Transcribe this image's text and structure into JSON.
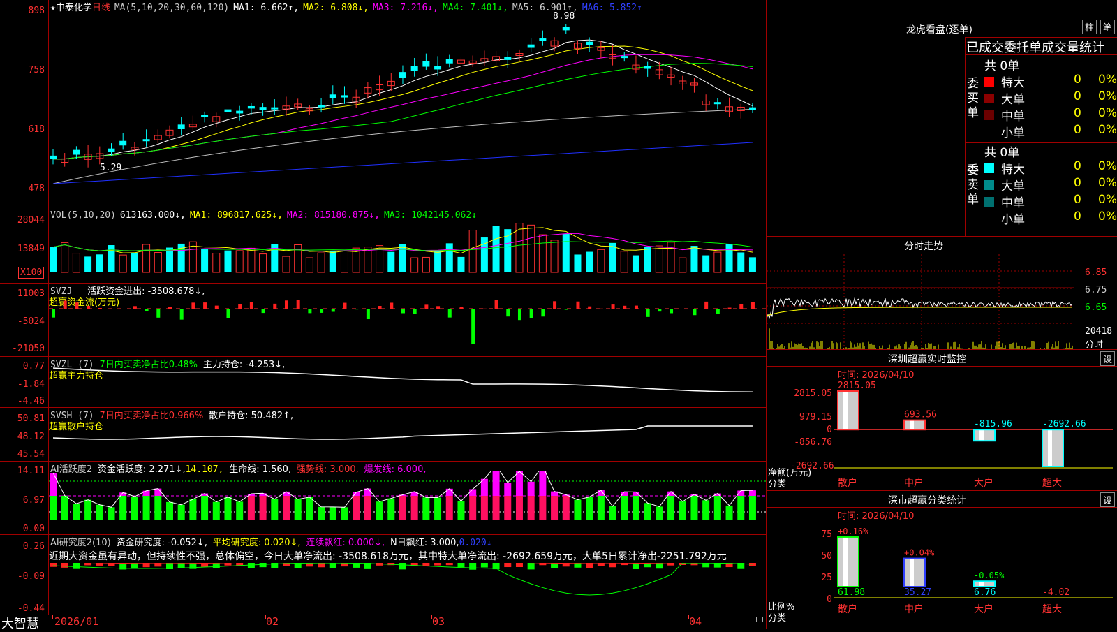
{
  "kline": {
    "star": "★",
    "stock_name": "中泰化学",
    "period": "日线",
    "ma_label": "MA(5,10,20,30,60,120)",
    "ma1": "MA1: 6.662↑,",
    "ma2": "MA2: 6.808↓,",
    "ma3": "MA3: 7.216↓,",
    "ma4": "MA4: 7.401↓,",
    "ma5": "MA5: 6.901↑,",
    "ma6": "MA6: 5.852↑",
    "y_ticks": [
      "898",
      "758",
      "618",
      "478"
    ],
    "high_mark": "8.98",
    "low_mark": "5.29"
  },
  "vol": {
    "label": "VOL(5,10,20)",
    "value": "613163.000↓,",
    "ma1": "MA1: 896817.625↓,",
    "ma2": "MA2: 815180.875↓,",
    "ma3": "MA3: 1042145.062↓",
    "y_ticks": [
      "28044",
      "13849"
    ],
    "unit": "X100"
  },
  "svzj": {
    "label": "SVZJ",
    "title": "活跃资金进出: -3508.678↓,",
    "subtitle": "超赢资金流(万元)",
    "y_ticks": [
      "11003",
      "-5024",
      "-21050"
    ]
  },
  "svzl": {
    "label": "SVZL (7)",
    "net": "7日内买卖净占比0.48%",
    "hold": "主力持仓: -4.253↓,",
    "subtitle": "超赢主力持仓",
    "y_ticks": [
      "0.77",
      "-1.84",
      "-4.46"
    ]
  },
  "svsh": {
    "label": "SVSH (7)",
    "net": "7日内买卖净占比0.966%",
    "hold": "散户持仓: 50.482↑,",
    "subtitle": "超赢散户持仓",
    "y_ticks": [
      "50.81",
      "48.12",
      "45.54"
    ]
  },
  "ai_active": {
    "label": "AI活跃度2",
    "v1": "资金活跃度: 2.271↓,",
    "v2": "14.107,",
    "v3": "生命线: 1.560,",
    "v4": "强势线: 3.000,",
    "v5": "爆发线: 6.000,",
    "y_ticks": [
      "14.11",
      "6.97",
      "0.00"
    ]
  },
  "ai_research": {
    "label": "AI研究度2(10)",
    "v1": "资金研究度: -0.052↓,",
    "v2": "平均研究度: 0.020↓,",
    "v3": "连续飘红: 0.000↓,",
    "v4": "N日飘红: 3.000,",
    "v5": "0.020↓",
    "note": "近期大资金虽有异动，但持续性不强，总体偏空，今日大单净流出: -3508.618万元，其中特大单净流出: -2692.659万元，大单5日累计净出-2251.792万元",
    "y_ticks": [
      "0.26",
      "-0.09",
      "-0.44"
    ]
  },
  "xaxis": {
    "brand": "大智慧",
    "labels": [
      "2026/01",
      "02",
      "03",
      "04"
    ]
  },
  "right": {
    "title": "龙虎看盘(逐单)",
    "btn_col": "柱",
    "btn_pen": "笔",
    "subheader": "已成交委托单成交量统计",
    "buy_side": "委买单",
    "sell_side": "委卖单",
    "buy_total": "共 0单",
    "sell_total": "共 0单",
    "rows": [
      {
        "name": "特大",
        "val": "0",
        "pct": "0%"
      },
      {
        "name": "大单",
        "val": "0",
        "pct": "0%"
      },
      {
        "name": "中单",
        "val": "0",
        "pct": "0%"
      },
      {
        "name": "小单",
        "val": "0",
        "pct": "0%"
      }
    ],
    "intraday_title": "分时走势",
    "intraday_ticks": [
      "6.85",
      "6.75",
      "6.65"
    ],
    "intraday_vol": "20418",
    "intraday_unit": "分时",
    "monitor_title": "深圳超赢实时监控",
    "monitor_set": "设",
    "monitor_time": "时间: 2026/04/10",
    "monitor_ticks": [
      "2815.05",
      "979.15",
      "0",
      "-856.76",
      "-2692.66"
    ],
    "monitor_ylabel": "净额(万元)",
    "monitor_xlabel": "分类",
    "monitor_cats": [
      "散户",
      "中户",
      "大户",
      "超大"
    ],
    "monitor_vals": [
      "2815.05",
      "693.56",
      "-815.96",
      "-2692.66"
    ],
    "stat_title": "深市超赢分类统计",
    "stat_set": "设",
    "stat_time": "时间: 2026/04/10",
    "stat_ticks": [
      "75",
      "50",
      "25",
      "0"
    ],
    "stat_ylabel": "比例%",
    "stat_xlabel": "分类",
    "stat_top": [
      "+0.16%",
      "+0.04%",
      "-0.05%",
      ""
    ],
    "stat_bottom": [
      "61.98",
      "35.27",
      "6.76",
      "-4.02"
    ],
    "stat_cats": [
      "散户",
      "中户",
      "大户",
      "超大"
    ]
  },
  "colors": {
    "up": "#ff3232",
    "down": "#00ffff",
    "bg": "#000000",
    "grid": "#a00000"
  },
  "chart_data": [
    {
      "type": "bar",
      "title": "深圳超赢实时监控",
      "categories": [
        "散户",
        "中户",
        "大户",
        "超大"
      ],
      "values": [
        2815.05,
        693.56,
        -815.96,
        -2692.66
      ],
      "ylim": [
        -2692.66,
        2815.05
      ]
    },
    {
      "type": "bar",
      "title": "深市超赢分类统计",
      "categories": [
        "散户",
        "中户",
        "大户",
        "超大"
      ],
      "values": [
        61.98,
        35.27,
        6.76,
        -4.02
      ],
      "ylim": [
        0,
        75
      ]
    }
  ]
}
